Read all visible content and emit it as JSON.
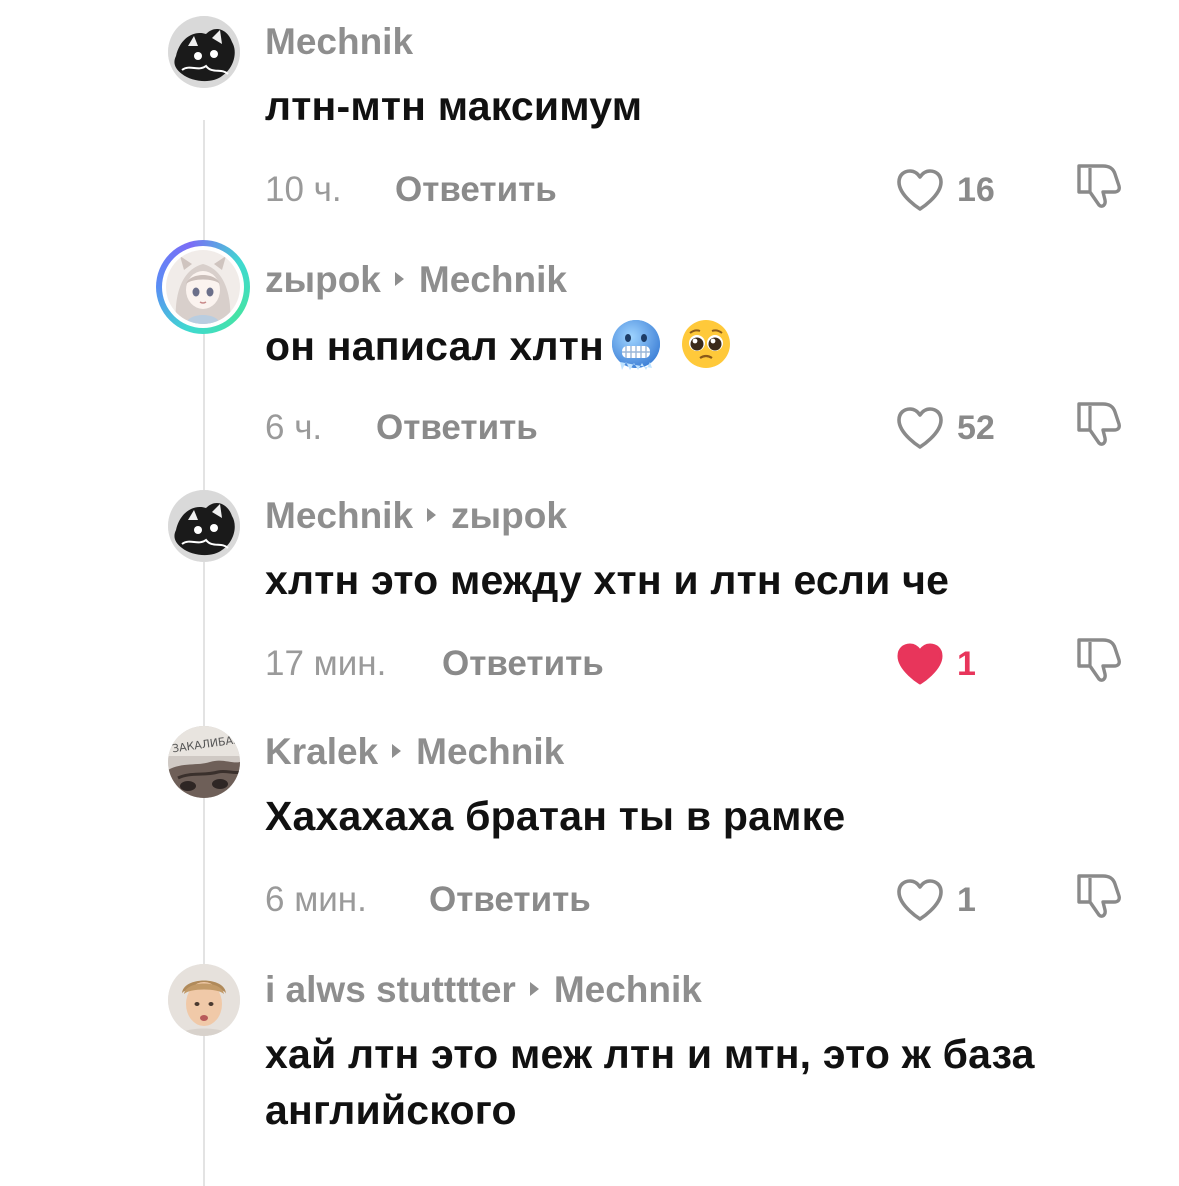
{
  "thread": {
    "reply_label": "Ответить",
    "comments": [
      {
        "author": "Mechnik",
        "reply_to": "",
        "text": "лтн-мтн максимум",
        "time": "10 ч.",
        "likes": "16",
        "liked": false,
        "emojis": [],
        "avatar_icon": "bw-cat-avatar-icon"
      },
      {
        "author": "zыpok",
        "reply_to": "Mechnik",
        "text": "он написал хлтн",
        "time": "6 ч.",
        "likes": "52",
        "liked": false,
        "emojis": [
          "cold-face-emoji",
          "pleading-face-emoji"
        ],
        "avatar_icon": "anime-girl-avatar-icon"
      },
      {
        "author": "Mechnik",
        "reply_to": "zыpok",
        "text": "хлтн это между хтн и лтн если че",
        "time": "17 мин.",
        "likes": "1",
        "liked": true,
        "emojis": [],
        "avatar_icon": "bw-cat-avatar-icon"
      },
      {
        "author": "Kralek",
        "reply_to": "Mechnik",
        "text": "Хахахаха братан ты в рамке",
        "time": "6 мин.",
        "likes": "1",
        "liked": false,
        "emojis": [],
        "avatar_icon": "car-photo-avatar-icon"
      },
      {
        "author": "i alws stutttter",
        "reply_to": "Mechnik",
        "text": "хай лтн это меж лтн и мтн, это ж база английского",
        "time": "",
        "likes": "",
        "liked": false,
        "emojis": [],
        "avatar_icon": "person-photo-avatar-icon"
      }
    ]
  },
  "colors": {
    "meta_gray": "#8e8e8e",
    "text": "#111111",
    "liked_red": "#e8355b",
    "thread_line": "#e3e3e3"
  }
}
